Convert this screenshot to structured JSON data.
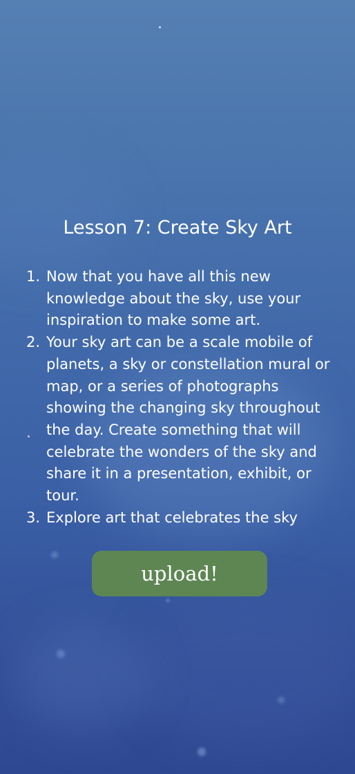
{
  "lesson": {
    "title": "Lesson 7: Create Sky Art",
    "steps": [
      {
        "number": "1.",
        "text": "Now that you have all this new knowledge about the sky, use your inspiration to make some art."
      },
      {
        "number": "2.",
        "text": "Your sky art can be a scale mobile of planets, a sky or constellation mural or map, or a series of photographs showing the changing sky throughout the day. Create something that will celebrate the wonders of the sky and share it in a presentation, exhibit, or tour."
      },
      {
        "number": "3.",
        "text": "Explore art that celebrates the sky"
      }
    ]
  },
  "actions": {
    "upload_label": "upload!"
  },
  "colors": {
    "background_top": "#5580b4",
    "background_bottom": "#2f4892",
    "button": "#5d8653",
    "text": "#ffffff"
  }
}
